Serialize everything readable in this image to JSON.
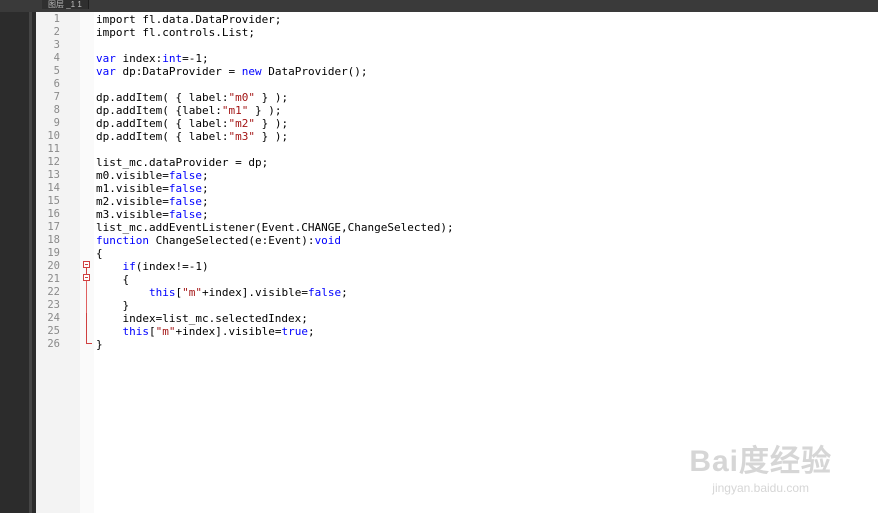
{
  "window": {
    "tab_title": "图层 _1 1"
  },
  "editor": {
    "lines": [
      {
        "num": "1",
        "segments": [
          {
            "t": "import fl.data.DataProvider;",
            "c": ""
          }
        ]
      },
      {
        "num": "2",
        "segments": [
          {
            "t": "import fl.controls.List;",
            "c": ""
          }
        ]
      },
      {
        "num": "3",
        "segments": []
      },
      {
        "num": "4",
        "segments": [
          {
            "t": "var",
            "c": "kw"
          },
          {
            "t": " index:",
            "c": ""
          },
          {
            "t": "int",
            "c": "kw"
          },
          {
            "t": "=-1;",
            "c": ""
          }
        ]
      },
      {
        "num": "5",
        "segments": [
          {
            "t": "var",
            "c": "kw"
          },
          {
            "t": " dp:DataProvider = ",
            "c": ""
          },
          {
            "t": "new",
            "c": "kw"
          },
          {
            "t": " DataProvider();",
            "c": ""
          }
        ]
      },
      {
        "num": "6",
        "segments": []
      },
      {
        "num": "7",
        "segments": [
          {
            "t": "dp.addItem( { label:",
            "c": ""
          },
          {
            "t": "\"m0\"",
            "c": "str"
          },
          {
            "t": " } );",
            "c": ""
          }
        ]
      },
      {
        "num": "8",
        "segments": [
          {
            "t": "dp.addItem( {label:",
            "c": ""
          },
          {
            "t": "\"m1\"",
            "c": "str"
          },
          {
            "t": " } );",
            "c": ""
          }
        ]
      },
      {
        "num": "9",
        "segments": [
          {
            "t": "dp.addItem( { label:",
            "c": ""
          },
          {
            "t": "\"m2\"",
            "c": "str"
          },
          {
            "t": " } );",
            "c": ""
          }
        ]
      },
      {
        "num": "10",
        "segments": [
          {
            "t": "dp.addItem( { label:",
            "c": ""
          },
          {
            "t": "\"m3\"",
            "c": "str"
          },
          {
            "t": " } );",
            "c": ""
          }
        ]
      },
      {
        "num": "11",
        "segments": []
      },
      {
        "num": "12",
        "segments": [
          {
            "t": "list_mc.dataProvider = dp;",
            "c": ""
          }
        ]
      },
      {
        "num": "13",
        "segments": [
          {
            "t": "m0.visible=",
            "c": ""
          },
          {
            "t": "false",
            "c": "kw"
          },
          {
            "t": ";",
            "c": ""
          }
        ]
      },
      {
        "num": "14",
        "segments": [
          {
            "t": "m1.visible=",
            "c": ""
          },
          {
            "t": "false",
            "c": "kw"
          },
          {
            "t": ";",
            "c": ""
          }
        ]
      },
      {
        "num": "15",
        "segments": [
          {
            "t": "m2.visible=",
            "c": ""
          },
          {
            "t": "false",
            "c": "kw"
          },
          {
            "t": ";",
            "c": ""
          }
        ]
      },
      {
        "num": "16",
        "segments": [
          {
            "t": "m3.visible=",
            "c": ""
          },
          {
            "t": "false",
            "c": "kw"
          },
          {
            "t": ";",
            "c": ""
          }
        ]
      },
      {
        "num": "17",
        "segments": [
          {
            "t": "list_mc.addEventListener(Event.CHANGE,ChangeSelected);",
            "c": ""
          }
        ]
      },
      {
        "num": "18",
        "segments": [
          {
            "t": "function",
            "c": "kw"
          },
          {
            "t": " ChangeSelected(e:Event):",
            "c": ""
          },
          {
            "t": "void",
            "c": "kw"
          }
        ]
      },
      {
        "num": "19",
        "segments": [
          {
            "t": "{",
            "c": ""
          }
        ]
      },
      {
        "num": "20",
        "segments": [
          {
            "t": "    ",
            "c": ""
          },
          {
            "t": "if",
            "c": "kw"
          },
          {
            "t": "(index!=-1)",
            "c": ""
          }
        ]
      },
      {
        "num": "21",
        "segments": [
          {
            "t": "    {",
            "c": ""
          }
        ]
      },
      {
        "num": "22",
        "segments": [
          {
            "t": "        ",
            "c": ""
          },
          {
            "t": "this",
            "c": "kw"
          },
          {
            "t": "[",
            "c": ""
          },
          {
            "t": "\"m\"",
            "c": "str"
          },
          {
            "t": "+index].visible=",
            "c": ""
          },
          {
            "t": "false",
            "c": "kw"
          },
          {
            "t": ";",
            "c": ""
          }
        ]
      },
      {
        "num": "23",
        "segments": [
          {
            "t": "    }",
            "c": ""
          }
        ]
      },
      {
        "num": "24",
        "segments": [
          {
            "t": "    index=list_mc.selectedIndex;",
            "c": ""
          }
        ]
      },
      {
        "num": "25",
        "segments": [
          {
            "t": "    ",
            "c": ""
          },
          {
            "t": "this",
            "c": "kw"
          },
          {
            "t": "[",
            "c": ""
          },
          {
            "t": "\"m\"",
            "c": "str"
          },
          {
            "t": "+index].visible=",
            "c": ""
          },
          {
            "t": "true",
            "c": "kw"
          },
          {
            "t": ";",
            "c": ""
          }
        ]
      },
      {
        "num": "26",
        "segments": [
          {
            "t": "}",
            "c": ""
          }
        ]
      }
    ]
  },
  "watermark": {
    "logo": "Bai度经验",
    "url": "jingyan.baidu.com"
  },
  "colors": {
    "keyword": "#0000ff",
    "string": "#a31515",
    "fold_marker": "#d04040"
  }
}
